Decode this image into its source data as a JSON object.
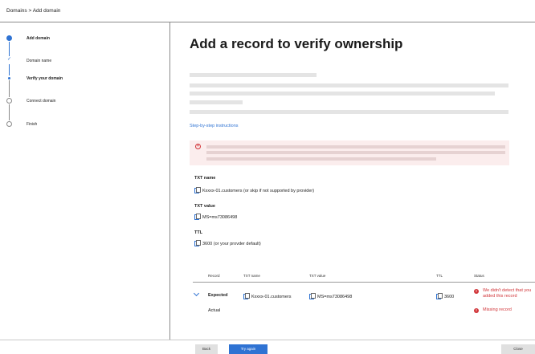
{
  "breadcrumb": "Domains > Add domain",
  "steps": [
    {
      "label": "Add domain",
      "state": "current-section"
    },
    {
      "label": "Domain name",
      "state": "done"
    },
    {
      "label": "Verify your domain",
      "state": "current"
    },
    {
      "label": "Connect domain",
      "state": "pending"
    },
    {
      "label": "Finish",
      "state": "pending"
    }
  ],
  "page_title": "Add a record to verify ownership",
  "instructions_link": "Step-by-step instructions",
  "fields": {
    "txt_name_label": "TXT name",
    "txt_name_value": "Kxxxx-01.customers (or skip if not supported by provider)",
    "txt_value_label": "TXT value",
    "txt_value_value": "MS=ms73086498",
    "ttl_label": "TTL",
    "ttl_value": "3600 (or your provder default)"
  },
  "table": {
    "headers": [
      "Record",
      "TXT name",
      "TXT value",
      "TTL",
      "Status"
    ],
    "expected": {
      "record": "Expected",
      "txt_name": "Kxxxx-01.customers",
      "txt_value": "MS=ms73086498",
      "ttl": "3600",
      "status": "We didn't detect that you added this record"
    },
    "actual": {
      "record": "Actual",
      "status": "Missing record"
    }
  },
  "buttons": {
    "back": "Back",
    "try_again": "Try again",
    "close": "Close"
  },
  "colors": {
    "accent": "#2f73d3",
    "error": "#d13438",
    "error_bg": "#fbeded"
  }
}
